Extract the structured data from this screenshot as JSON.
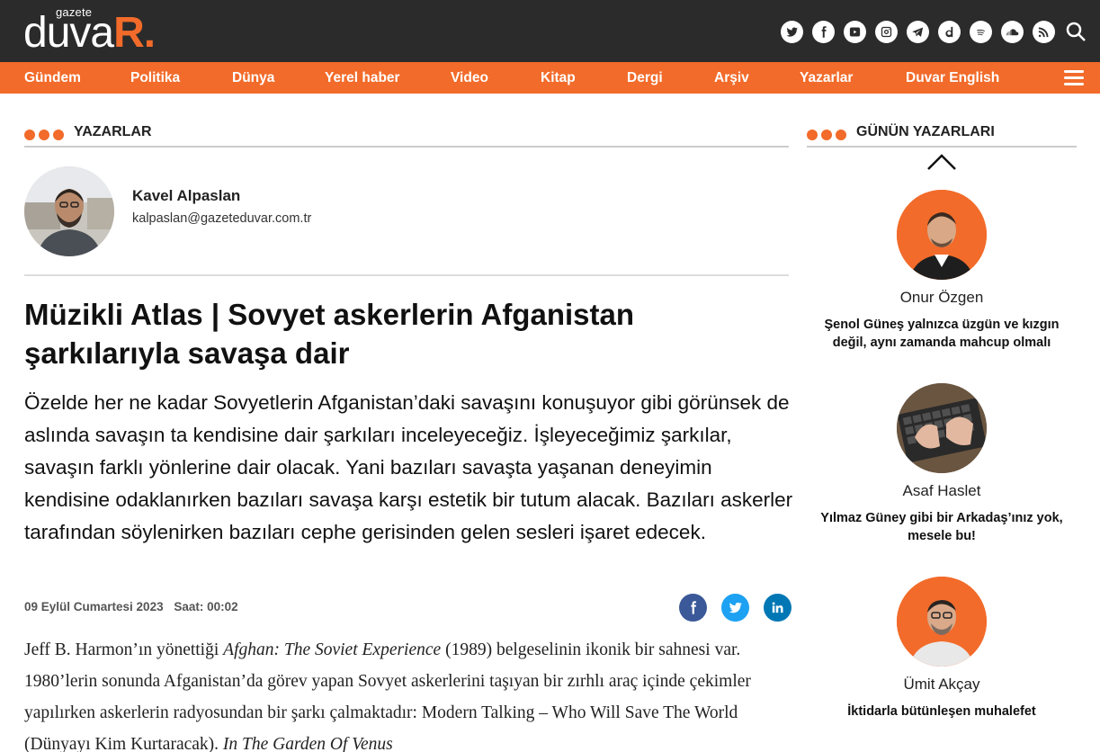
{
  "header": {
    "logo_small": "gazete",
    "logo_main": "duva",
    "logo_r": "R."
  },
  "social_icons": [
    "twitter-icon",
    "facebook-icon",
    "youtube-icon",
    "instagram-icon",
    "telegram-icon",
    "dailymotion-icon",
    "spotify-icon",
    "soundcloud-icon",
    "rss-icon",
    "search-icon"
  ],
  "nav": {
    "items": [
      "Gündem",
      "Politika",
      "Dünya",
      "Yerel haber",
      "Video",
      "Kitap",
      "Dergi",
      "Arşiv",
      "Yazarlar",
      "Duvar English"
    ]
  },
  "colors": {
    "accent": "#f26b2a",
    "header_bg": "#2b2b2b",
    "facebook": "#3b5998",
    "twitter": "#1da1f2",
    "linkedin": "#0077b5"
  },
  "main": {
    "section_title": "YAZARLAR",
    "author": {
      "name": "Kavel Alpaslan",
      "email": "kalpaslan@gazeteduvar.com.tr"
    },
    "article": {
      "title": "Müzikli Atlas | Sovyet askerlerin Afganistan şarkılarıyla savaşa dair",
      "lead": "Özelde her ne kadar Sovyetlerin Afganistan’daki savaşını konuşuyor gibi görünsek de aslında savaşın ta kendisine dair şarkıları inceleyeceğiz. İşleyeceğimiz şarkılar, savaşın farklı yönlerine dair olacak. Yani bazıları savaşta yaşanan deneyimin kendisine odaklanırken bazıları savaşa karşı estetik bir tutum alacak. Bazıları askerler tarafından söylenirken bazıları cephe gerisinden gelen sesleri işaret edecek.",
      "date": "09 Eylül Cumartesi 2023",
      "time": "Saat: 00:02",
      "body_p1": "Jeff B. Harmon’ın yönettiği ",
      "body_em1": "Afghan: The Soviet Experience",
      "body_p2": " (1989) belgeselinin ikonik bir sahnesi var. 1980’lerin sonunda Afganistan’da görev yapan Sovyet askerlerini taşıyan bir zırhlı araç içinde çekimler yapılırken askerlerin radyosundan bir şarkı çalmaktadır: Modern Talking – Who Will Save The World (Dünyayı Kim Kurtaracak). ",
      "body_em2": "In The Garden Of Venus"
    }
  },
  "sidebar": {
    "section_title": "GÜNÜN YAZARLARI",
    "writers": [
      {
        "name": "Onur Özgen",
        "title": "Şenol Güneş yalnızca üzgün ve kızgın değil, aynı zamanda mahcup olmalı"
      },
      {
        "name": "Asaf Haslet",
        "title": "Yılmaz Güney gibi bir Arkadaş’ınız yok, mesele bu!"
      },
      {
        "name": "Ümit Akçay",
        "title": "İktidarla bütünleşen muhalefet"
      }
    ]
  }
}
